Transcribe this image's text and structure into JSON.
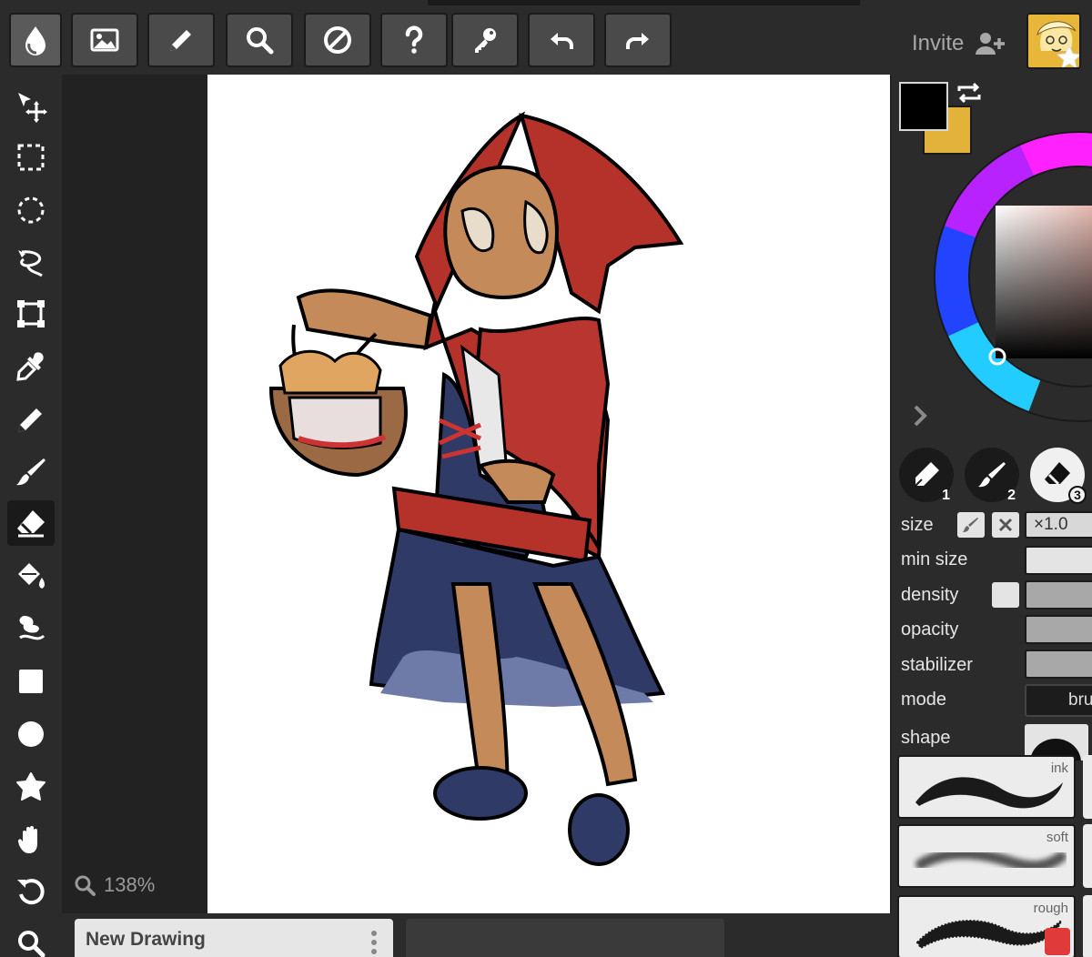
{
  "header": {
    "invite_label": "Invite"
  },
  "top_toolbar": {
    "buttons": [
      "logo-icon",
      "image-icon",
      "pencil-icon",
      "magnifier-icon",
      "contrast-icon",
      "question-icon",
      "key-icon",
      "undo-icon",
      "redo-icon"
    ]
  },
  "left_tools": [
    "move-select-icon",
    "rect-select-icon",
    "ellipse-select-icon",
    "lasso-icon",
    "transform-icon",
    "eyedropper-icon",
    "pencil-icon",
    "brush-icon",
    "eraser-icon",
    "fill-bucket-icon",
    "smudge-icon",
    "square-icon",
    "circle-icon",
    "shape-icon",
    "hand-icon",
    "rotate-icon",
    "zoom-icon"
  ],
  "canvas": {
    "zoom_label": "138%"
  },
  "tabs": {
    "active_title": "New Drawing"
  },
  "colors": {
    "primary": "#000000",
    "secondary": "#e2b23a",
    "accent": "#e2b23a"
  },
  "brush_slots": [
    {
      "num": "1",
      "icon": "pen-icon"
    },
    {
      "num": "2",
      "icon": "brush-icon"
    },
    {
      "num": "3",
      "icon": "eraser-icon"
    }
  ],
  "brush_props": {
    "size_label": "size",
    "size_mult": "×1.0",
    "min_size_label": "min size",
    "density_label": "density",
    "opacity_label": "opacity",
    "stabilizer_label": "stabilizer",
    "mode_label": "mode",
    "mode_value": "bru",
    "shape_label": "shape"
  },
  "presets": [
    {
      "label": "ink"
    },
    {
      "label": "soft"
    },
    {
      "label": "rough"
    }
  ]
}
